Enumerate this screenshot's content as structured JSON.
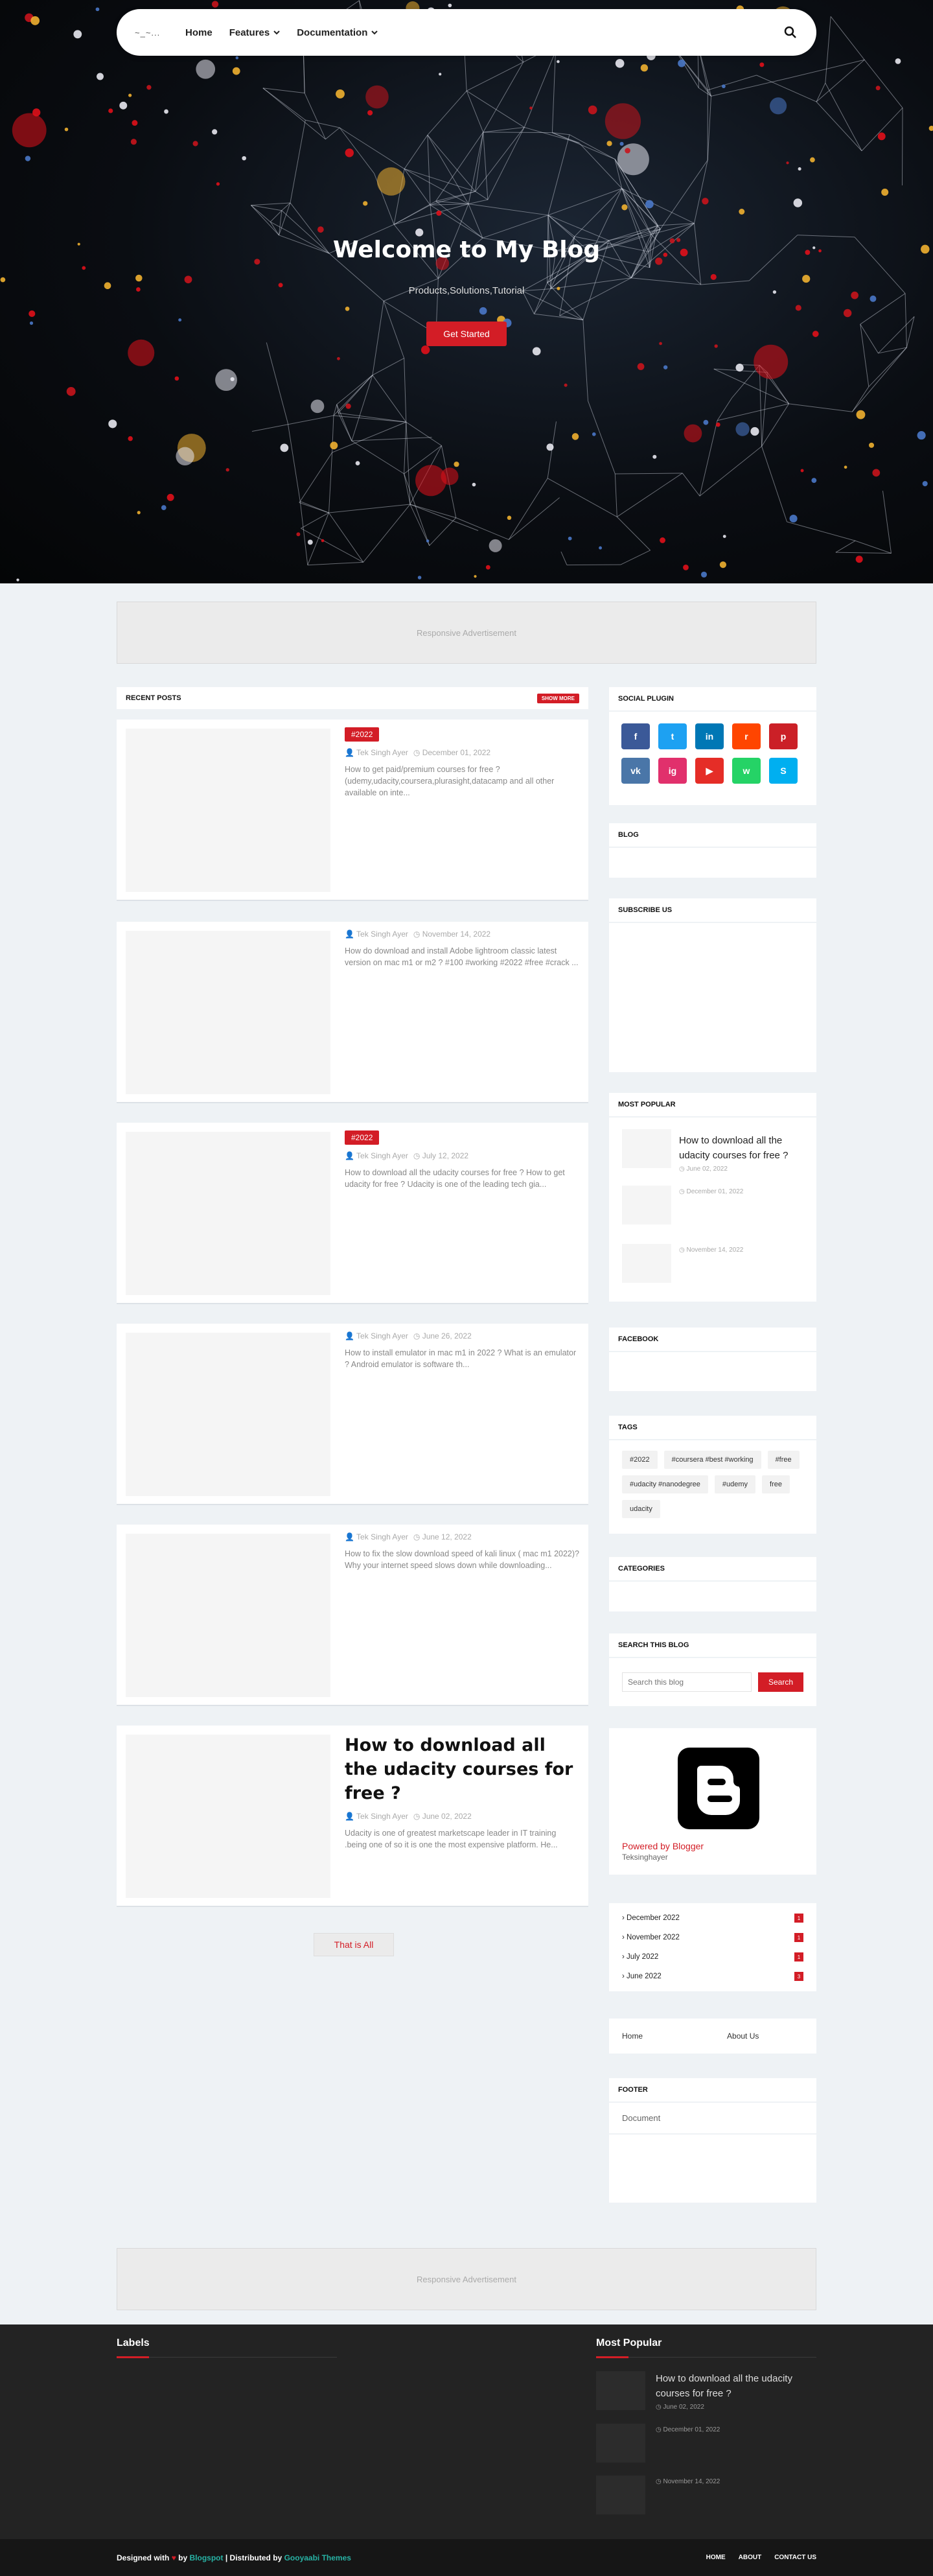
{
  "colors": {
    "accent": "#d31d26",
    "footer_accent": "#27b3a5",
    "background": "#eef2f5"
  },
  "nav": {
    "logo_text": "~_~...",
    "items": [
      {
        "label": "Home",
        "dropdown": false
      },
      {
        "label": "Features",
        "dropdown": true
      },
      {
        "label": "Documentation",
        "dropdown": true
      }
    ],
    "search_icon": "search-icon"
  },
  "hero": {
    "title": "Welcome to My Blog",
    "subtitle": "Products,Solutions,Tutorial",
    "button": "Get Started"
  },
  "ads": {
    "label": "Responsive Advertisement"
  },
  "recent": {
    "title": "RECENT POSTS",
    "show_more": "SHOW MORE",
    "posts": [
      {
        "tag": "#2022",
        "author": "Tek Singh Ayer",
        "date": "December 01, 2022",
        "excerpt": "How to get paid/premium courses for free ? (udemy,udacity,coursera,plurasight,datacamp and all other available on inte..."
      },
      {
        "tag": "",
        "author": "Tek Singh Ayer",
        "date": "November 14, 2022",
        "excerpt": "How do download and install Adobe lightroom classic latest version on mac m1 or m2 ? #100 #working #2022 #free #crack ..."
      },
      {
        "tag": "#2022",
        "author": "Tek Singh Ayer",
        "date": "July 12, 2022",
        "excerpt": "How to download all the udacity courses for free ? How to get udacity for free ? Udacity is one of the leading tech gia..."
      },
      {
        "tag": "",
        "author": "Tek Singh Ayer",
        "date": "June 26, 2022",
        "excerpt": "How to install emulator in mac m1 in 2022 ?     What is an emulator ?    Android emulator is software th..."
      },
      {
        "tag": "",
        "author": "Tek Singh Ayer",
        "date": "June 12, 2022",
        "excerpt": "How to fix the slow download speed of kali linux ( mac m1 2022)?  Why your internet speed slows down while downloading..."
      },
      {
        "title": "How to download all the udacity courses for free ?",
        "author": "Tek Singh Ayer",
        "date": "June 02, 2022",
        "excerpt": "Udacity is one of greatest marketscape leader in IT training .being one of so it is one the most expensive platform. He..."
      }
    ],
    "thats_all": "That is All"
  },
  "sidebar": {
    "social_title": "SOCIAL PLUGIN",
    "social": [
      {
        "name": "facebook-icon",
        "color": "#3b5998",
        "glyph": "f"
      },
      {
        "name": "twitter-icon",
        "color": "#1da1f2",
        "glyph": "t"
      },
      {
        "name": "linkedin-icon",
        "color": "#0077b5",
        "glyph": "in"
      },
      {
        "name": "reddit-icon",
        "color": "#ff4500",
        "glyph": "r"
      },
      {
        "name": "pinterest-icon",
        "color": "#cb2027",
        "glyph": "p"
      },
      {
        "name": "vk-icon",
        "color": "#4a76a8",
        "glyph": "vk"
      },
      {
        "name": "instagram-icon",
        "color": "#e1306c",
        "glyph": "ig"
      },
      {
        "name": "youtube-icon",
        "color": "#e52d27",
        "glyph": "▶"
      },
      {
        "name": "whatsapp-icon",
        "color": "#25d366",
        "glyph": "w"
      },
      {
        "name": "skype-icon",
        "color": "#00aff0",
        "glyph": "S"
      }
    ],
    "blog_title": "BLOG",
    "subscribe_title": "SUBSCRIBE US",
    "popular_title": "MOST POPULAR",
    "popular": [
      {
        "title": "How to download all the udacity courses for free ?",
        "date": "June 02, 2022"
      },
      {
        "title": "",
        "date": "December 01, 2022"
      },
      {
        "title": "",
        "date": "November 14, 2022"
      }
    ],
    "facebook_title": "FACEBOOK",
    "tags_title": "TAGS",
    "tags": [
      "#2022",
      "#coursera #best #working",
      "#free",
      "#udacity #nanodegree",
      "#udemy",
      "free",
      "udacity"
    ],
    "categories_title": "CATEGORIES",
    "search_title": "SEARCH THIS BLOG",
    "search_placeholder": "Search this blog",
    "search_button": "Search",
    "blogger": {
      "powered": "Powered by Blogger",
      "author": "Teksinghayer"
    },
    "archive": [
      {
        "label": "› December 2022",
        "count": "1"
      },
      {
        "label": "› November 2022",
        "count": "1"
      },
      {
        "label": "› July 2022",
        "count": "1"
      },
      {
        "label": "› June 2022",
        "count": "3"
      }
    ],
    "pages": [
      "Home",
      "About Us"
    ],
    "footer_title": "FOOTER",
    "footer_doc": "Document"
  },
  "footer": {
    "labels_title": "Labels",
    "popular_title": "Most Popular",
    "popular": [
      {
        "title": "How to download all the udacity courses for free ?",
        "date": "June 02, 2022"
      },
      {
        "title": "",
        "date": "December 01, 2022"
      },
      {
        "title": "",
        "date": "November 14, 2022"
      }
    ],
    "designed_with": "Designed with",
    "by": "by",
    "blogspot": "Blogspot",
    "distributed": "| Distributed by",
    "gooyaabi": "Gooyaabi Themes",
    "links": [
      "HOME",
      "ABOUT",
      "CONTACT US"
    ]
  }
}
